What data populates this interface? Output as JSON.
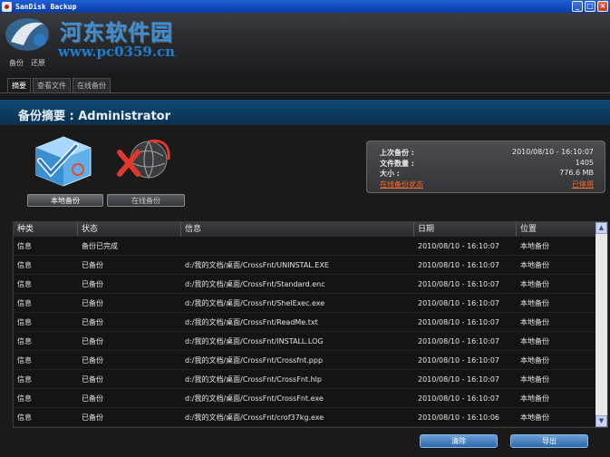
{
  "window": {
    "title": "SanDisk Backup"
  },
  "watermark": {
    "title": "河东软件园",
    "url": "www.pc0359.cn"
  },
  "menu": {
    "items": [
      "备份",
      "还原"
    ]
  },
  "tabs": [
    {
      "label": "摘要",
      "active": true
    },
    {
      "label": "查看文件",
      "active": false
    },
    {
      "label": "在线备份",
      "active": false
    }
  ],
  "summary": {
    "title": "备份摘要 : Administrator"
  },
  "actions": {
    "local_backup": "本地备份",
    "online_backup": "在线备份"
  },
  "info": {
    "last_backup_label": "上次备份 :",
    "last_backup_value": "2010/08/10 - 16:10:07",
    "file_count_label": "文件数量 :",
    "file_count_value": "1405",
    "size_label": "大小 :",
    "size_value": "776.6 MB",
    "online_status_link": "在线备份状态",
    "paused_link": "已停用"
  },
  "table": {
    "headers": [
      "种类",
      "状态",
      "信息",
      "日期",
      "位置"
    ],
    "rows": [
      [
        "信息",
        "备份已完成",
        "",
        "2010/08/10 - 16:10:07",
        "本地备份"
      ],
      [
        "信息",
        "已备份",
        "d:/我的文档/桌面/CrossFnt/UNINSTAL.EXE",
        "2010/08/10 - 16:10:07",
        "本地备份"
      ],
      [
        "信息",
        "已备份",
        "d:/我的文档/桌面/CrossFnt/Standard.enc",
        "2010/08/10 - 16:10:07",
        "本地备份"
      ],
      [
        "信息",
        "已备份",
        "d:/我的文档/桌面/CrossFnt/ShelExec.exe",
        "2010/08/10 - 16:10:07",
        "本地备份"
      ],
      [
        "信息",
        "已备份",
        "d:/我的文档/桌面/CrossFnt/ReadMe.txt",
        "2010/08/10 - 16:10:07",
        "本地备份"
      ],
      [
        "信息",
        "已备份",
        "d:/我的文档/桌面/CrossFnt/INSTALL.LOG",
        "2010/08/10 - 16:10:07",
        "本地备份"
      ],
      [
        "信息",
        "已备份",
        "d:/我的文档/桌面/CrossFnt/Crossfnt.ppp",
        "2010/08/10 - 16:10:07",
        "本地备份"
      ],
      [
        "信息",
        "已备份",
        "d:/我的文档/桌面/CrossFnt/CrossFnt.hlp",
        "2010/08/10 - 16:10:07",
        "本地备份"
      ],
      [
        "信息",
        "已备份",
        "d:/我的文档/桌面/CrossFnt/CrossFnt.exe",
        "2010/08/10 - 16:10:07",
        "本地备份"
      ],
      [
        "信息",
        "已备份",
        "d:/我的文档/桌面/CrossFnt/crof37kg.exe",
        "2010/08/10 - 16:10:06",
        "本地备份"
      ]
    ]
  },
  "buttons": {
    "clear": "清除",
    "export": "导出"
  },
  "colors": {
    "accent": "#0f4a74",
    "link": "#ff6a2a",
    "titlebar": "#1f5fd6"
  },
  "icons": [
    "app-icon",
    "minimize-icon",
    "maximize-icon",
    "close-icon",
    "local-backup-icon",
    "online-backup-icon",
    "logo-icon",
    "scroll-up-icon",
    "scroll-down-icon"
  ]
}
